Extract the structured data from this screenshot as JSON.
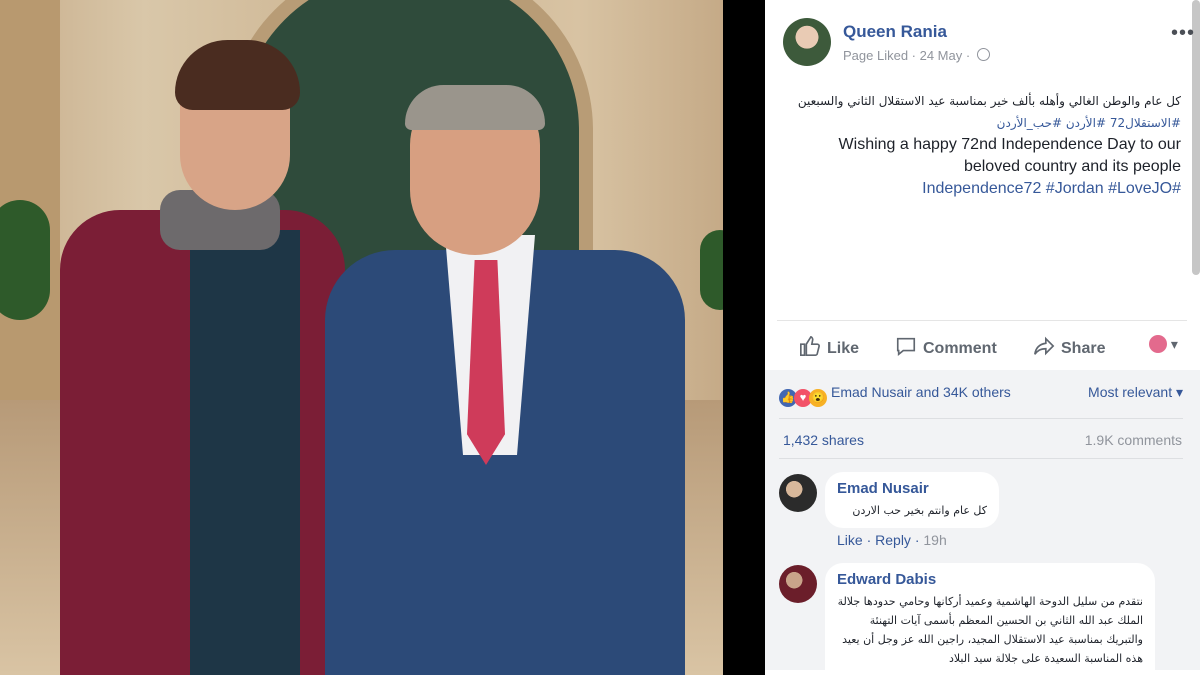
{
  "post": {
    "page_name": "Queen Rania",
    "meta": "Page Liked · 24 May ·",
    "more_label": "•••",
    "text_ar_1": "كل عام والوطن الغالي وأهله بألف خير بمناسبة عيد الاستقلال الثاني والسبعين",
    "tags_ar": "#الاستقلال72 #الأردن #حب_الأردن",
    "text_en": "Wishing a happy 72nd Independence Day to our beloved country and its people",
    "tags_en": "Independence72 #Jordan #LoveJO#"
  },
  "actions": {
    "like": "Like",
    "comment": "Comment",
    "share": "Share"
  },
  "reactions": {
    "names": "Emad Nusair and 34K others",
    "sort": "Most relevant ▾",
    "shares": "1,432 shares",
    "comments": "1.9K comments"
  },
  "comments": [
    {
      "author": "Emad Nusair",
      "body": "كل عام وانتم بخير حب الاردن",
      "like": "Like",
      "reply": "Reply",
      "time": "19h"
    },
    {
      "author": "Edward Dabis",
      "body": "نتقدم من سليل الدوحة الهاشمية وعميد أركانها وحامي حدودها جلالة الملك عبد الله الثاني بن الحسين المعظم بأسمى آيات التهنئة والتبريك بمناسبة عيد الاستقلال المجيد، راجين الله عز وجل أن يعيد هذه المناسبة السعيدة على جلالة سيد البلاد"
    }
  ],
  "colors": {
    "link": "#365899",
    "meta": "#90949c",
    "panel_bg": "#f2f3f5"
  }
}
